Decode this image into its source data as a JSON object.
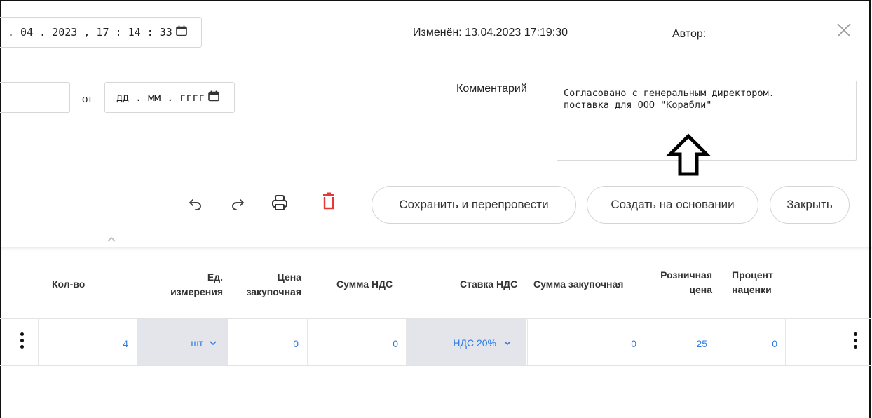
{
  "header": {
    "date_value": ". 04 . 2023 ,  17 : 14 : 33",
    "changed": "Изменён: 13.04.2023 17:19:30",
    "author_label": "Автор:"
  },
  "doc": {
    "ot_label": "от",
    "date_placeholder": "дд . мм . гггг"
  },
  "comment": {
    "label": "Комментарий",
    "text": "Согласовано с генеральным директором.\nпоставка для ООО \"Корабли\""
  },
  "toolbar": {
    "save_label": "Сохранить и перепровести",
    "create_label": "Создать на основании",
    "close_label": "Закрыть",
    "delete_color": "#e53935"
  },
  "table": {
    "columns": {
      "qty": "Кол-во",
      "unit_1": "Ед.",
      "unit_2": "измерения",
      "price_1": "Цена",
      "price_2": "закупочная",
      "vat_sum": "Сумма НДС",
      "vat_rate": "Ставка НДС",
      "purchase_sum": "Сумма закупочная",
      "retail_1": "Розничная",
      "retail_2": "цена",
      "markup_1": "Процент",
      "markup_2": "наценки"
    },
    "row": {
      "qty": "4",
      "unit": "шт",
      "price": "0",
      "vat_sum": "0",
      "vat_rate": "НДС 20%",
      "purchase_sum": "0",
      "retail": "25",
      "markup": "0"
    },
    "value_color": "#2f7de1"
  }
}
